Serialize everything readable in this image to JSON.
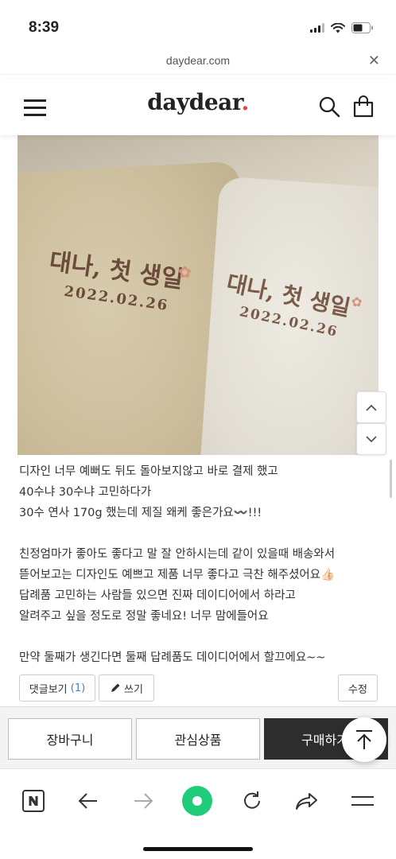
{
  "status": {
    "time": "8:39"
  },
  "url_bar": {
    "domain": "daydear.com"
  },
  "header": {
    "logo_text": "daydear",
    "logo_dot": ".",
    "logo_dot_color": "#e0463b"
  },
  "photo": {
    "embroidery_towel1_name": "대나, 첫 생일",
    "embroidery_towel1_date": "2022.02.26",
    "embroidery_towel2_name": "대나, 첫 생일",
    "embroidery_towel2_date": "2022.02.26"
  },
  "review": {
    "lines": [
      "디자인 너무 예뻐도 뒤도 돌아보지않고 바로 결제 했고",
      "40수냐 30수냐 고민하다가",
      "30수 연사 170g 했는데 제질 왜케 좋은가요〰️!!!",
      "",
      "친정엄마가 좋아도 좋다고 말 잘 안하시는데 같이 있을때 배송와서",
      "뜯어보고는 디자인도 예쁘고 제품 너무 좋다고 극찬 해주셨어요👍🏻",
      "답례품 고민하는 사람들 있으면 진짜 데이디어에서 하라고",
      "알려주고 싶을 정도로 정말 좋네요! 너무 맘에들어요",
      "",
      "만약 둘째가 생긴다면 둘째 답례품도 데이디어에서 할끄에요~~"
    ]
  },
  "review_actions": {
    "comments_label": "댓글보기",
    "comments_count": "(1)",
    "write_label": "쓰기",
    "edit_label": "수정"
  },
  "buy_bar": {
    "cart_label": "장바구니",
    "wishlist_label": "관심상품",
    "buy_label": "구매하기"
  },
  "colors": {
    "accent_green": "#1fcc7a",
    "buy_dark": "#2d2d2d",
    "link_blue": "#4a7bd0"
  }
}
